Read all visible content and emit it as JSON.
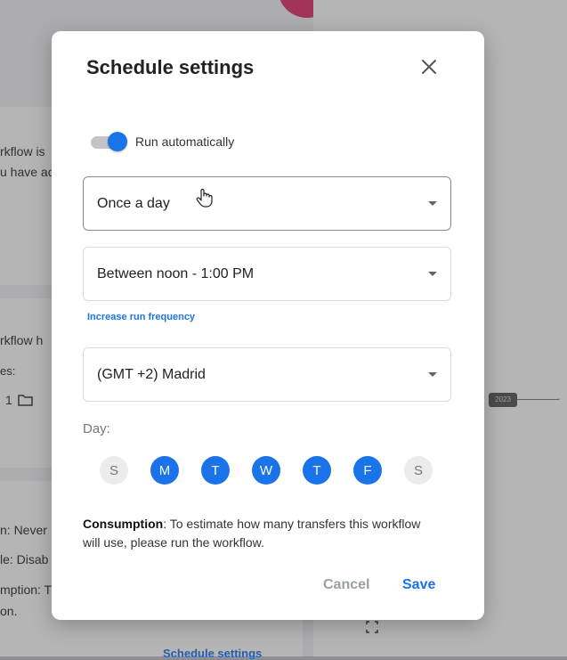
{
  "background": {
    "fragments": [
      "rkflow is",
      "u have ac",
      "rkflow h",
      "es:",
      "1",
      "n: Never",
      "le: Disab",
      "mption: T",
      "on."
    ],
    "node_label": "2023",
    "link": "Schedule settings"
  },
  "modal": {
    "title": "Schedule settings",
    "toggle_label": "Run automatically",
    "toggle_on": true,
    "frequency": "Once a day",
    "time_window": "Between noon - 1:00 PM",
    "frequency_link": "Increase run frequency",
    "timezone": "(GMT +2) Madrid",
    "day_label": "Day:",
    "days": [
      {
        "label": "S",
        "selected": false
      },
      {
        "label": "M",
        "selected": true
      },
      {
        "label": "T",
        "selected": true
      },
      {
        "label": "W",
        "selected": true
      },
      {
        "label": "T",
        "selected": true
      },
      {
        "label": "F",
        "selected": true
      },
      {
        "label": "S",
        "selected": false
      }
    ],
    "consumption_bold": "Consumption",
    "consumption_text": ": To estimate how many transfers this workflow will use, please run the workflow.",
    "cancel_label": "Cancel",
    "save_label": "Save"
  },
  "colors": {
    "accent": "#1a73e8",
    "toggle_track": "#c4c4c6",
    "day_off": "#ececec"
  }
}
